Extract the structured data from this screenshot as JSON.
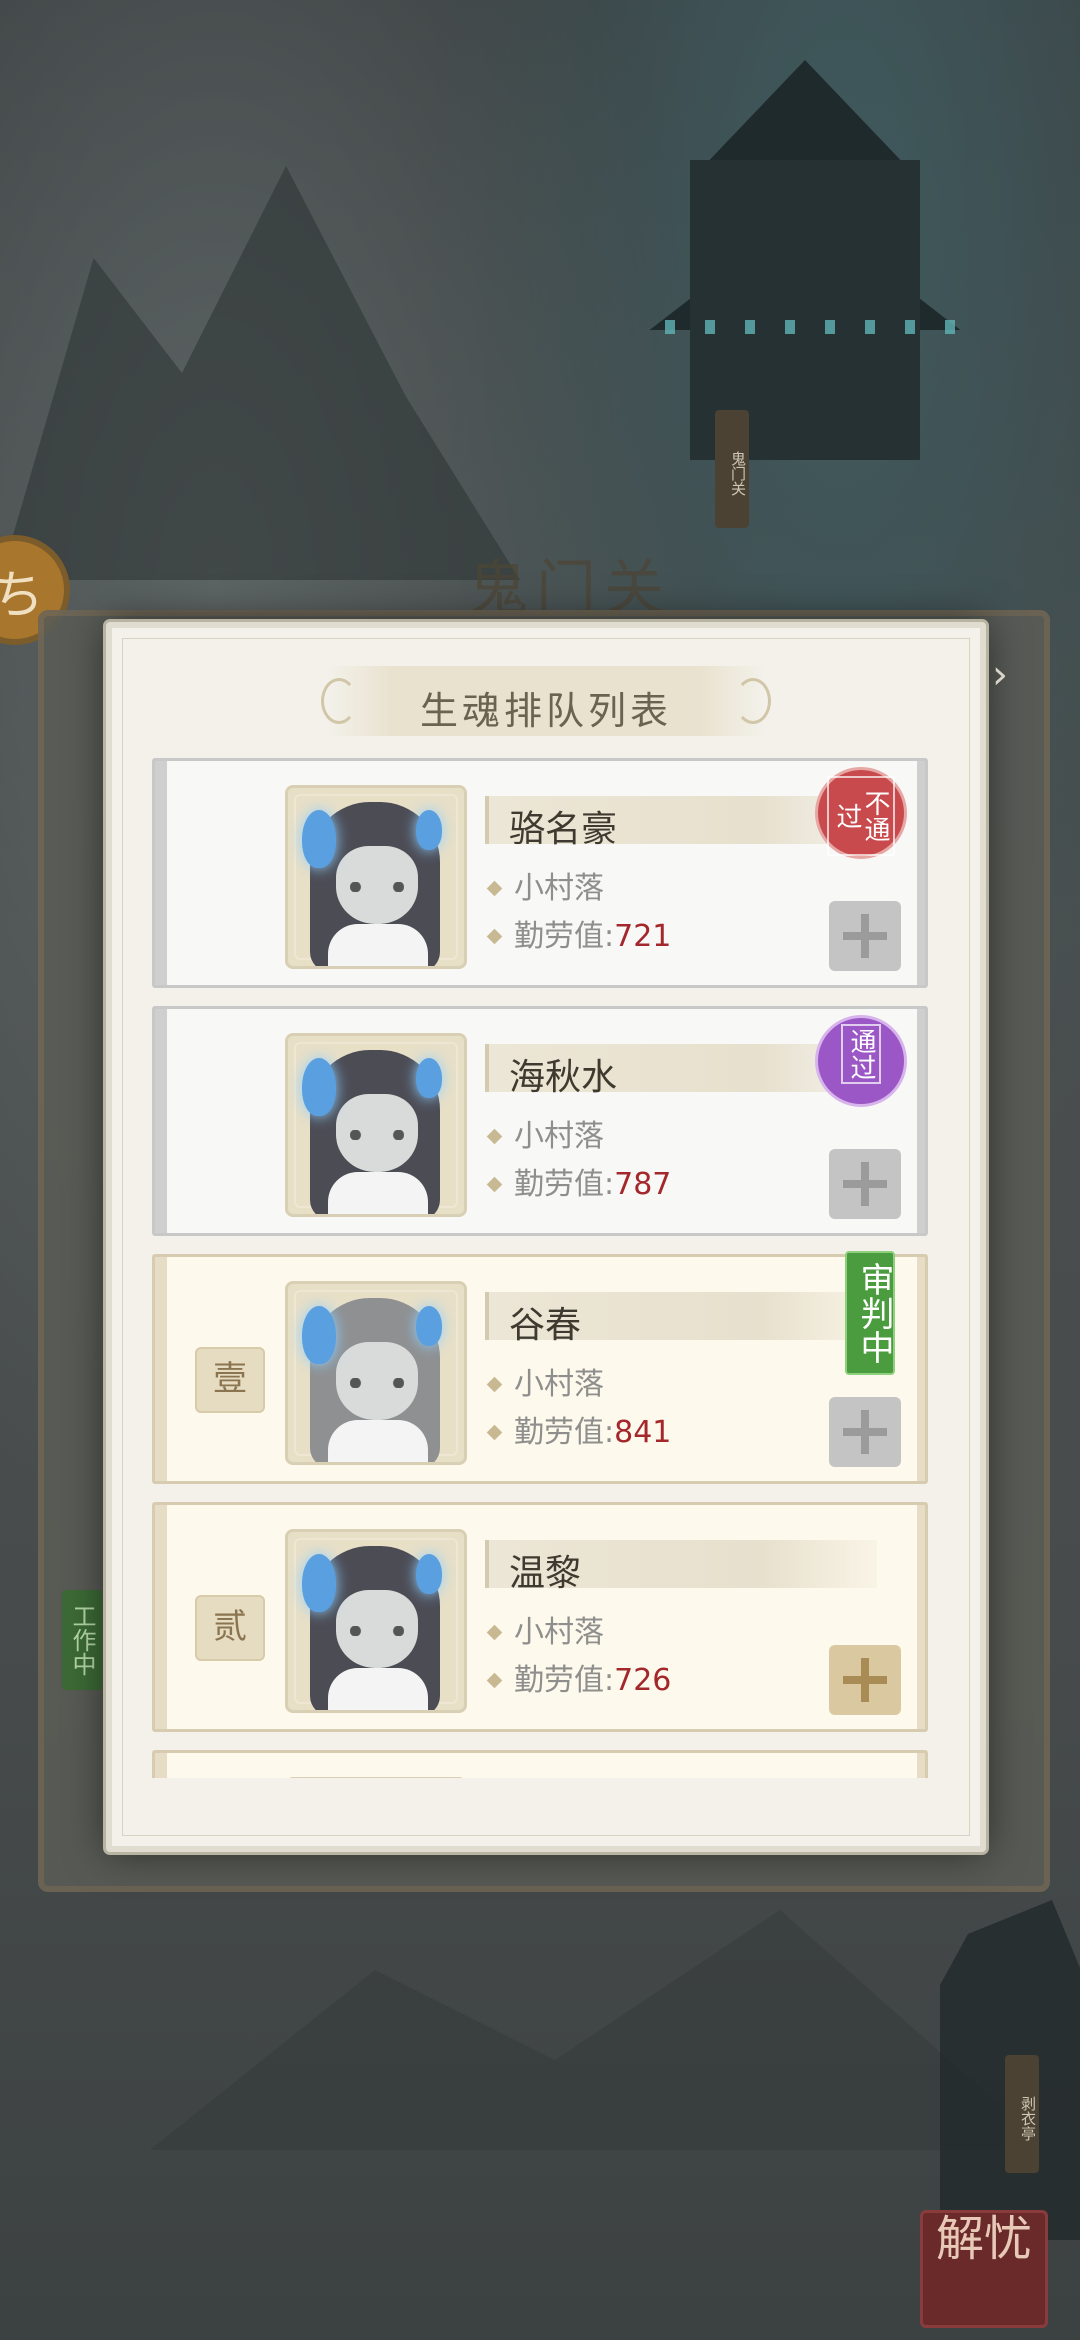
{
  "backdrop": {
    "scene_tag": "鬼门关",
    "title": "鬼门关",
    "work_badge": "工作中",
    "pavilion_tag": "剥衣亭",
    "corner_button": "解忧",
    "left_circle_glyph": "ち"
  },
  "modal": {
    "title": "生魂排队列表",
    "close_glyph": "›",
    "labels": {
      "value_prefix": "勤劳值:"
    },
    "entries": [
      {
        "name": "骆名豪",
        "location": "小村落",
        "value_label": "勤劳值:",
        "value": "721",
        "rank": "",
        "status": "不通过",
        "status_type": "fail",
        "hair": "dark"
      },
      {
        "name": "海秋水",
        "location": "小村落",
        "value_label": "勤劳值:",
        "value": "787",
        "rank": "",
        "status": "通过",
        "status_type": "pass",
        "hair": "dark"
      },
      {
        "name": "谷春",
        "location": "小村落",
        "value_label": "勤劳值:",
        "value": "841",
        "rank": "壹",
        "status": "审判中",
        "status_type": "judging",
        "hair": "grey"
      },
      {
        "name": "温黎",
        "location": "小村落",
        "value_label": "勤劳值:",
        "value": "726",
        "rank": "贰",
        "status": "",
        "status_type": "none",
        "hair": "dark"
      },
      {
        "name": "",
        "location": "",
        "value_label": "",
        "value": "",
        "rank": "",
        "status": "",
        "status_type": "none",
        "hair": "dark"
      }
    ]
  },
  "colors": {
    "value_number": "#a3272b",
    "fail_stamp": "#c94a4c",
    "pass_stamp": "#9b57c5",
    "judging_badge": "#4b9b3f",
    "active_card_bg": "#fdf9ec"
  }
}
